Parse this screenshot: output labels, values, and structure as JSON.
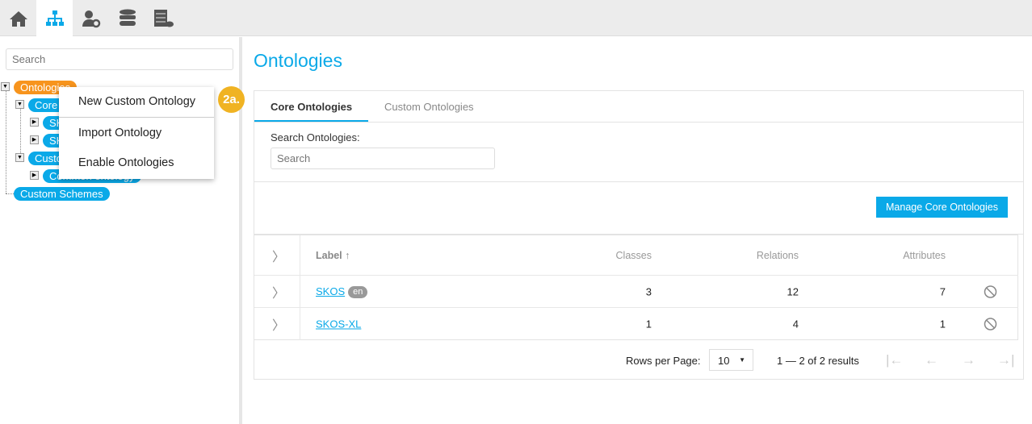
{
  "topbar": {
    "icons": [
      "home-icon",
      "sitemap-icon",
      "user-gear-icon",
      "database-icon",
      "server-cloud-icon"
    ],
    "active": 1,
    "active_color": "#0aa9e8"
  },
  "sidebar": {
    "search_placeholder": "Search",
    "tree": {
      "root": "Ontologies",
      "core": "Core Ontologies",
      "core_children": [
        "SKOS",
        "SKOS-XL"
      ],
      "custom": "Custom Ontologies",
      "custom_children": [
        "Common ontology"
      ],
      "schemes": "Custom Schemes"
    }
  },
  "context_menu": {
    "items": [
      "New Custom Ontology",
      "Import Ontology",
      "Enable Ontologies"
    ],
    "step_badge": "2a."
  },
  "main": {
    "title": "Ontologies",
    "tabs": [
      "Core Ontologies",
      "Custom Ontologies"
    ],
    "active_tab": 0,
    "search_label": "Search Ontologies:",
    "search_placeholder": "Search",
    "manage_button": "Manage Core Ontologies",
    "table": {
      "headers": {
        "label": "Label",
        "sort": "↑",
        "classes": "Classes",
        "relations": "Relations",
        "attributes": "Attributes"
      },
      "rows": [
        {
          "label": "SKOS",
          "lang": "en",
          "classes": "3",
          "relations": "12",
          "attributes": "7"
        },
        {
          "label": "SKOS-XL",
          "lang": "",
          "classes": "1",
          "relations": "4",
          "attributes": "1"
        }
      ]
    },
    "pager": {
      "rows_label": "Rows per Page:",
      "rows_value": "10",
      "range": "1 — 2 of 2 results"
    }
  },
  "colors": {
    "accent": "#0aa9e8",
    "orange": "#f7941d",
    "badge": "#f0b323"
  }
}
